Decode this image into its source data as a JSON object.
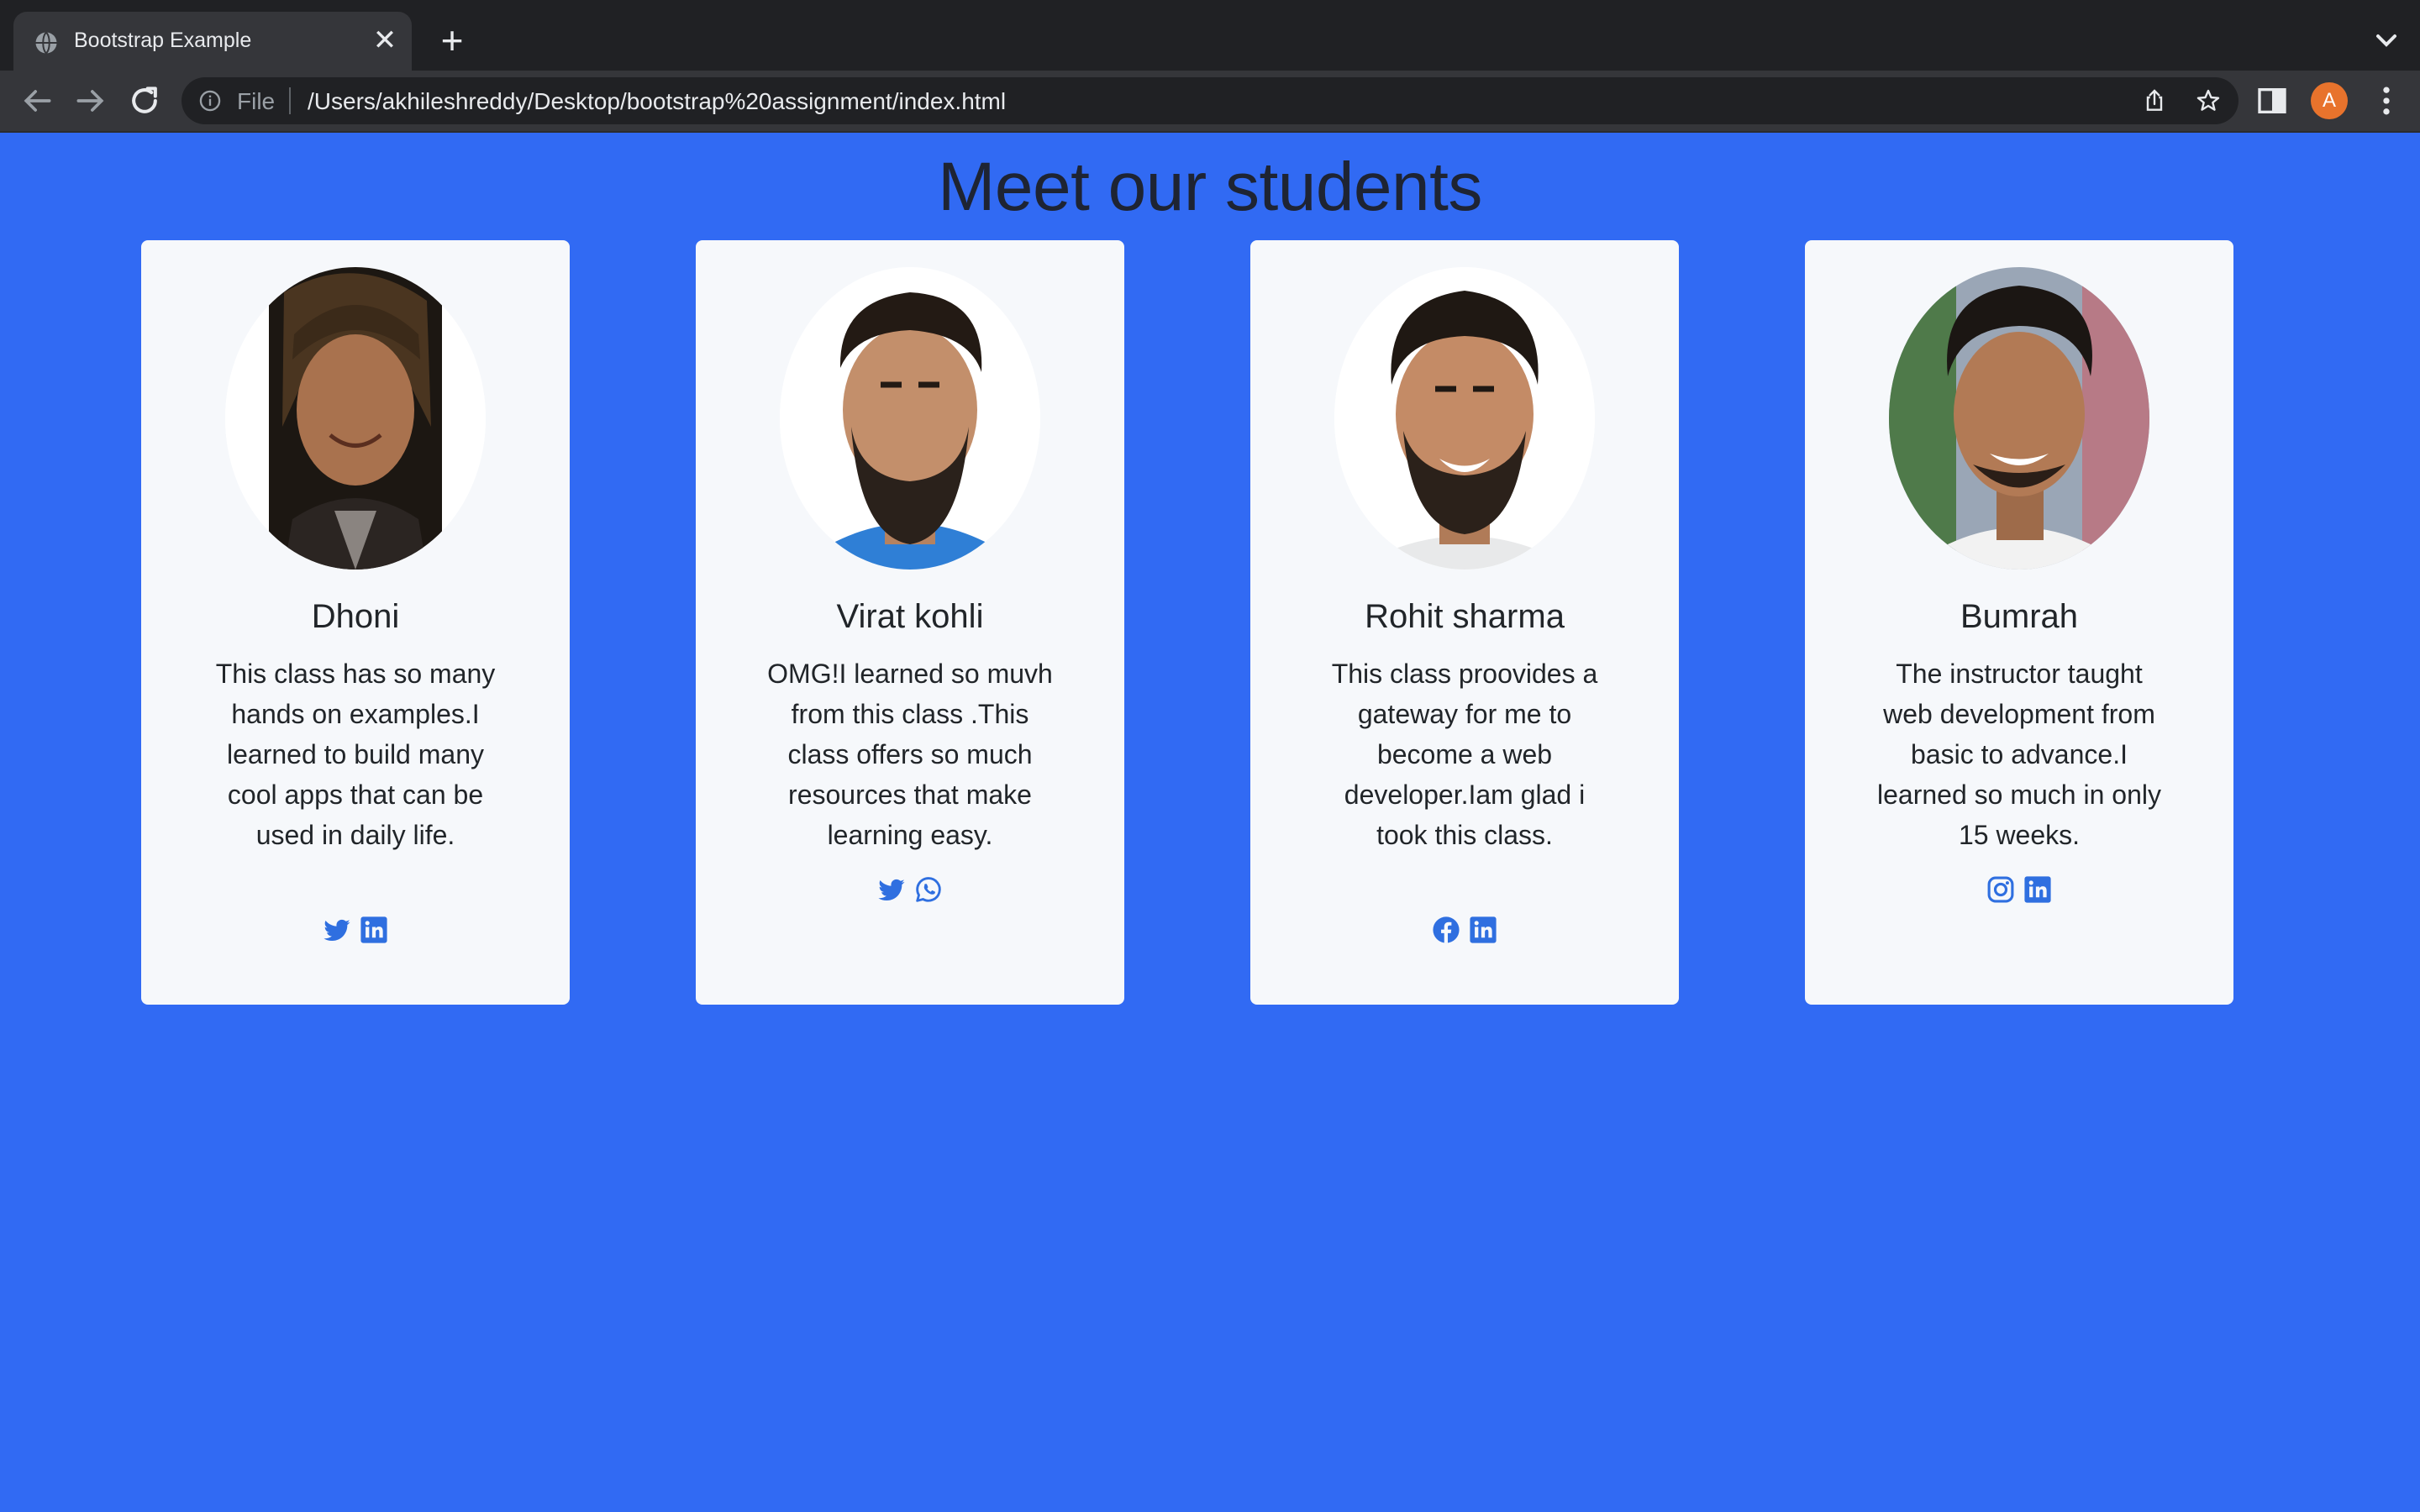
{
  "browser": {
    "tab_title": "Bootstrap Example",
    "tab_close": "✕",
    "new_tab": "+",
    "url_scheme": "File",
    "url": "/Users/akhileshreddy/Desktop/bootstrap%20assignment/index.html",
    "profile_initial": "A"
  },
  "page": {
    "title": "Meet our students",
    "background": "#316af3",
    "icon_color": "#2f6fe0"
  },
  "students": [
    {
      "name": "Dhoni",
      "description": "This class has so many hands on examples.I learned to build many cool apps that can be used in daily life.",
      "socials": [
        "twitter-icon",
        "linkedin-icon"
      ]
    },
    {
      "name": "Virat kohli",
      "description": "OMG!I learned so muvh from this class .This class offers so much resources that make learning easy.",
      "socials": [
        "twitter-icon",
        "whatsapp-icon"
      ]
    },
    {
      "name": "Rohit sharma",
      "description": "This class proovides a gateway for me to become a web developer.Iam glad i took this class.",
      "socials": [
        "facebook-icon",
        "linkedin-icon"
      ]
    },
    {
      "name": "Bumrah",
      "description": "The instructor taught web development from basic to advance.I learned so much in only 15 weeks.",
      "socials": [
        "instagram-icon",
        "linkedin-icon"
      ]
    }
  ]
}
